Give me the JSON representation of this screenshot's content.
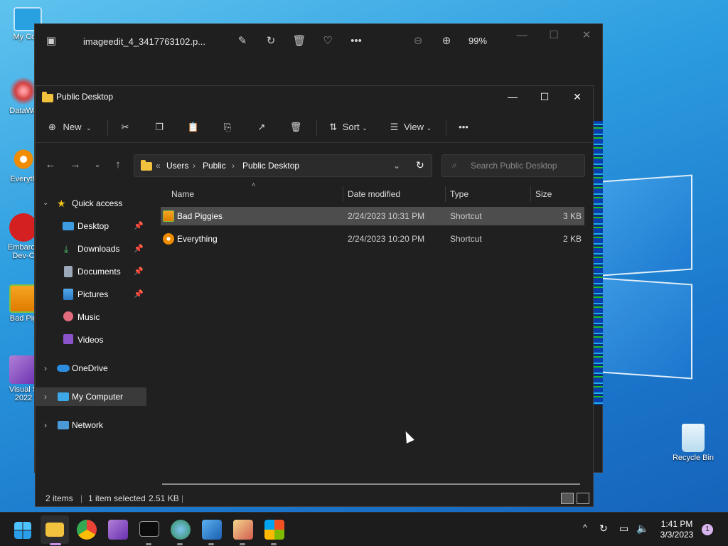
{
  "desktop": {
    "icons": [
      {
        "label": "My Com",
        "icon": "monitor-icon"
      },
      {
        "label": "DataWa",
        "icon": "datawave-icon"
      },
      {
        "label": "Everyth",
        "icon": "everything-icon"
      },
      {
        "label": "Embarca Dev-C",
        "icon": "devcpp-icon"
      },
      {
        "label": "Bad Pig",
        "icon": "bad-piggies-icon"
      },
      {
        "label": "Visual S 2022",
        "icon": "visual-studio-icon"
      }
    ],
    "recycle_bin": "Recycle Bin"
  },
  "photos": {
    "filename": "imageedit_4_3417763102.p...",
    "zoom": "99%"
  },
  "explorer": {
    "title": "Public Desktop",
    "toolbar": {
      "new": "New",
      "sort": "Sort",
      "view": "View"
    },
    "breadcrumb": [
      "«",
      "Users",
      "Public",
      "Public Desktop"
    ],
    "search_placeholder": "Search Public Desktop",
    "nav": {
      "quick_access": "Quick access",
      "items": [
        "Desktop",
        "Downloads",
        "Documents",
        "Pictures",
        "Music",
        "Videos"
      ],
      "onedrive": "OneDrive",
      "my_computer": "My Computer",
      "network": "Network"
    },
    "columns": {
      "name": "Name",
      "date": "Date modified",
      "type": "Type",
      "size": "Size"
    },
    "files": [
      {
        "name": "Bad Piggies",
        "date": "2/24/2023 10:31 PM",
        "type": "Shortcut",
        "size": "3 KB"
      },
      {
        "name": "Everything",
        "date": "2/24/2023 10:20 PM",
        "type": "Shortcut",
        "size": "2 KB"
      }
    ],
    "status": {
      "count": "2 items",
      "selected": "1 item selected",
      "size": "2.51 KB"
    }
  },
  "taskbar": {
    "time": "1:41 PM",
    "date": "3/3/2023",
    "notifications": "1"
  },
  "colors": {
    "accent": "#0078d4",
    "folder": "#f1c23d"
  }
}
